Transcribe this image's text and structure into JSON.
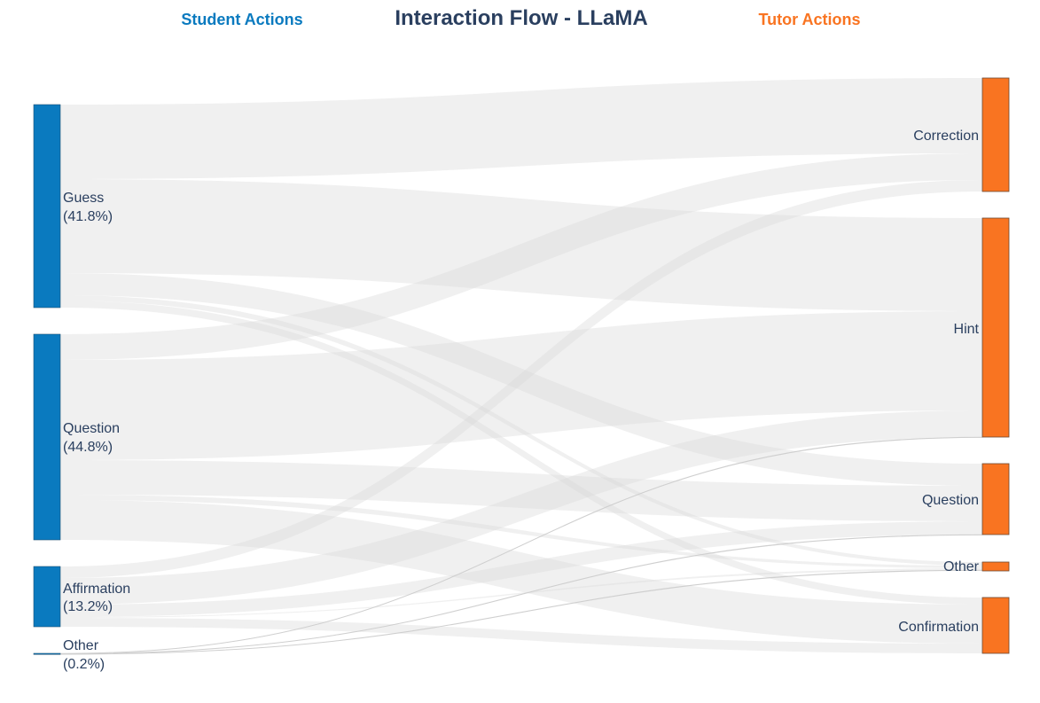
{
  "title": "Interaction Flow - LLaMA",
  "student_header": "Student Actions",
  "tutor_header": "Tutor Actions",
  "colors": {
    "student": "#0a7abf",
    "tutor": "#f97421",
    "title": "#2a3f5f",
    "link": "#d9d9d9"
  },
  "nodes": {
    "student": [
      {
        "id": "guess",
        "name": "Guess",
        "pct": "(41.8%)"
      },
      {
        "id": "question",
        "name": "Question",
        "pct": "(44.8%)"
      },
      {
        "id": "affirmation",
        "name": "Affirmation",
        "pct": "(13.2%)"
      },
      {
        "id": "other",
        "name": "Other",
        "pct": "(0.2%)"
      }
    ],
    "tutor": [
      {
        "id": "correction",
        "name": "Correction"
      },
      {
        "id": "hint",
        "name": "Hint"
      },
      {
        "id": "question",
        "name": "Question"
      },
      {
        "id": "other",
        "name": "Other"
      },
      {
        "id": "confirmation",
        "name": "Confirmation"
      }
    ]
  }
}
